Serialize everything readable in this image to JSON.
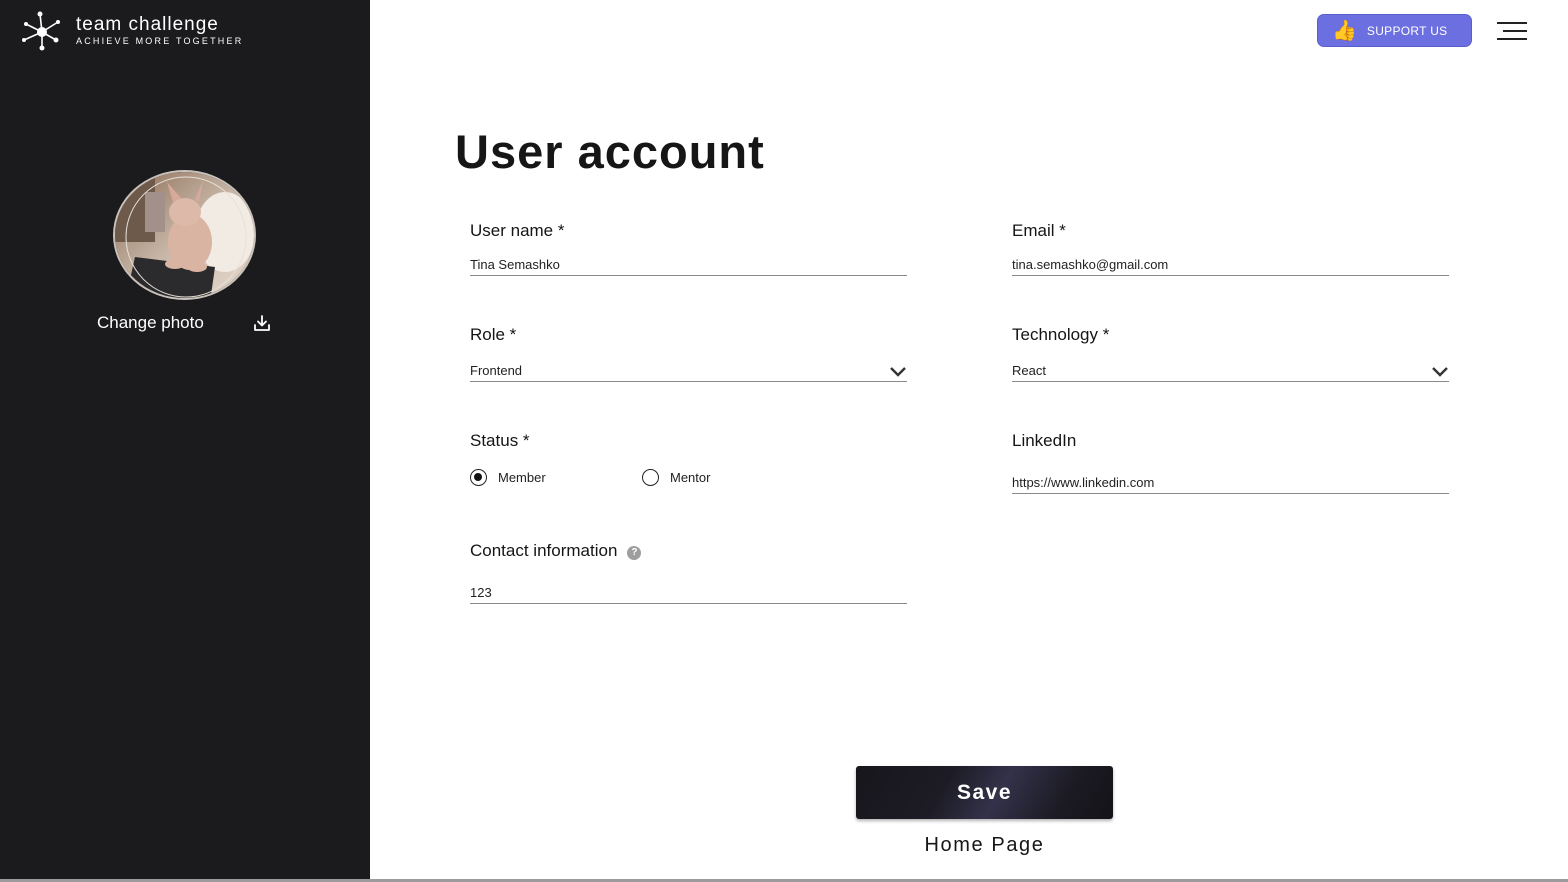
{
  "brand": {
    "title": "team challenge",
    "tagline": "ACHIEVE MORE TOGETHER"
  },
  "sidebar": {
    "change_photo_label": "Change photo",
    "avatar_icon": "avatar",
    "upload_icon": "download-icon"
  },
  "header": {
    "support_label": "SUPPORT US",
    "support_icon": "👍",
    "support_color": "#6c6fe0",
    "menu_icon": "hamburger-menu-icon"
  },
  "page": {
    "title": "User account"
  },
  "form": {
    "username": {
      "label": "User name *",
      "value": "Tina Semashko"
    },
    "email": {
      "label": "Email *",
      "value": "tina.semashko@gmail.com"
    },
    "role": {
      "label": "Role *",
      "value": "Frontend"
    },
    "technology": {
      "label": "Technology *",
      "value": "React"
    },
    "status": {
      "label": "Status *",
      "options": [
        {
          "label": "Member",
          "checked": true
        },
        {
          "label": "Mentor",
          "checked": false
        }
      ]
    },
    "linkedin": {
      "label": "LinkedIn",
      "value": "https://www.linkedin.com"
    },
    "contact": {
      "label": "Contact information",
      "value": "123",
      "help": "?"
    }
  },
  "actions": {
    "save_label": "Save",
    "home_label": "Home Page"
  },
  "colors": {
    "sidebar_bg": "#1b1a1c",
    "accent": "#6c6fe0"
  }
}
